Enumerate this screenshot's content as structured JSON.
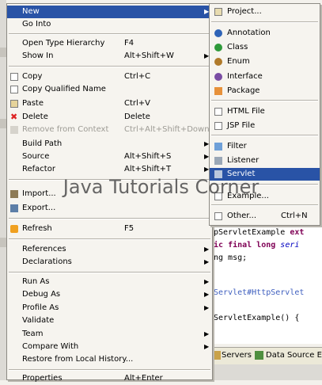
{
  "menu": {
    "new": "New",
    "go_into": "Go Into",
    "open_type_hierarchy": "Open Type Hierarchy",
    "open_type_hierarchy_acc": "F4",
    "show_in": "Show In",
    "show_in_acc": "Alt+Shift+W",
    "copy": "Copy",
    "copy_acc": "Ctrl+C",
    "copy_qualified_name": "Copy Qualified Name",
    "paste": "Paste",
    "paste_acc": "Ctrl+V",
    "delete": "Delete",
    "delete_acc": "Delete",
    "remove_from_context": "Remove from Context",
    "remove_from_context_acc": "Ctrl+Alt+Shift+Down",
    "build_path": "Build Path",
    "source": "Source",
    "source_acc": "Alt+Shift+S",
    "refactor": "Refactor",
    "refactor_acc": "Alt+Shift+T",
    "import": "Import...",
    "export": "Export...",
    "refresh": "Refresh",
    "refresh_acc": "F5",
    "references": "References",
    "declarations": "Declarations",
    "run_as": "Run As",
    "debug_as": "Debug As",
    "profile_as": "Profile As",
    "validate": "Validate",
    "team": "Team",
    "compare_with": "Compare With",
    "restore_local_history": "Restore from Local History...",
    "properties": "Properties",
    "properties_acc": "Alt+Enter"
  },
  "submenu": {
    "project": "Project...",
    "annotation": "Annotation",
    "class": "Class",
    "enum": "Enum",
    "interface": "Interface",
    "package": "Package",
    "html_file": "HTML File",
    "jsp_file": "JSP File",
    "filter": "Filter",
    "listener": "Listener",
    "servlet": "Servlet",
    "example": "Example...",
    "other": "Other...",
    "other_acc": "Ctrl+N"
  },
  "editor": {
    "line1a": "pServletExample ",
    "line1b": "ext",
    "line2a": "ic ",
    "line2b": "final long ",
    "line2c": "seri",
    "line3": "ng msg;",
    "line4": "Servlet#HttpServlet",
    "line5": "ServletExample() {"
  },
  "bottom_tabs": {
    "servers": "Servers",
    "data_source": "Data Source Exp"
  },
  "watermark": "Java Tutorials Corner"
}
